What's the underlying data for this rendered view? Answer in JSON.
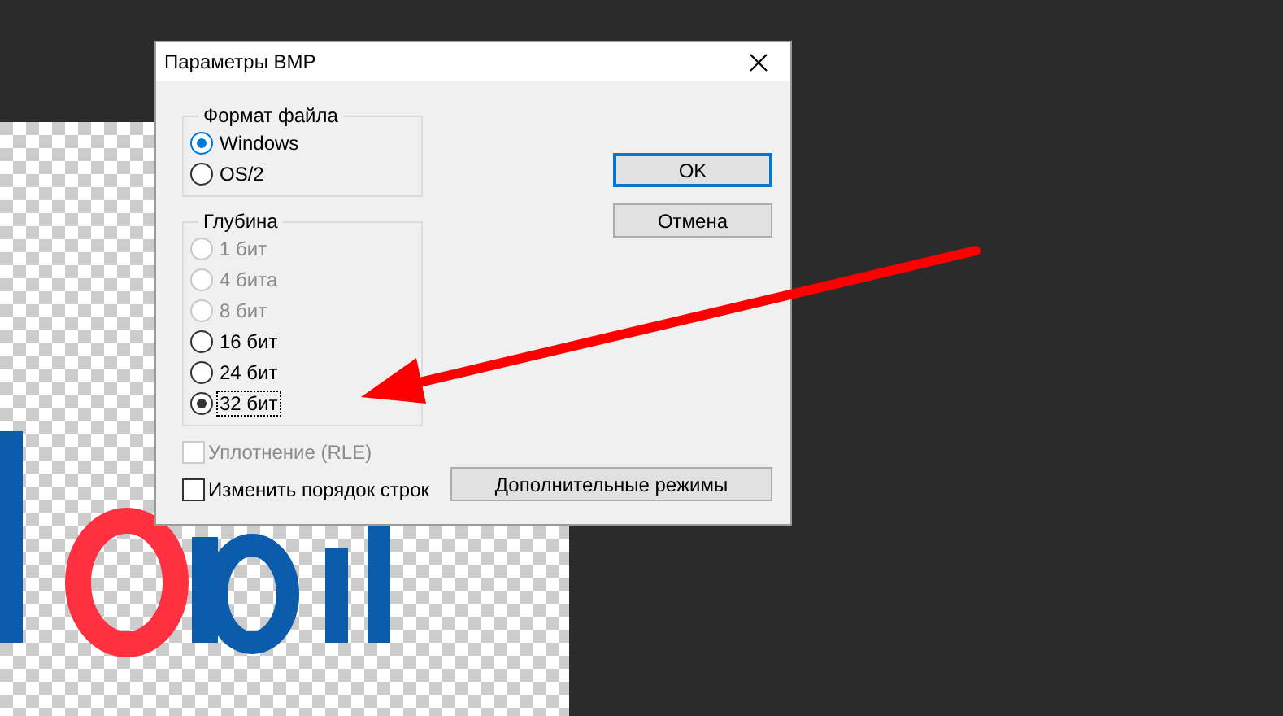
{
  "window": {
    "title": "Параметры BMP"
  },
  "file_format": {
    "label": "Формат файла",
    "options": [
      {
        "label": "Windows",
        "selected": true,
        "disabled": false,
        "focused": false
      },
      {
        "label": "OS/2",
        "selected": false,
        "disabled": false,
        "focused": false
      }
    ]
  },
  "depth": {
    "label": "Глубина",
    "options": [
      {
        "label": "1 бит",
        "selected": false,
        "disabled": true,
        "focused": false
      },
      {
        "label": "4 бита",
        "selected": false,
        "disabled": true,
        "focused": false
      },
      {
        "label": "8 бит",
        "selected": false,
        "disabled": true,
        "focused": false
      },
      {
        "label": "16 бит",
        "selected": false,
        "disabled": false,
        "focused": false
      },
      {
        "label": "24 бит",
        "selected": false,
        "disabled": false,
        "focused": false
      },
      {
        "label": "32 бит",
        "selected": true,
        "disabled": false,
        "focused": true
      }
    ]
  },
  "checkboxes": [
    {
      "label": "Уплотнение (RLE)",
      "checked": false,
      "disabled": true
    },
    {
      "label": "Изменить порядок строк",
      "checked": false,
      "disabled": false
    }
  ],
  "buttons": [
    {
      "label": "OK",
      "default": true
    },
    {
      "label": "Отмена",
      "default": false
    }
  ],
  "advanced_button": {
    "label": "Дополнительные режимы"
  },
  "annotation": {
    "kind": "arrow"
  }
}
